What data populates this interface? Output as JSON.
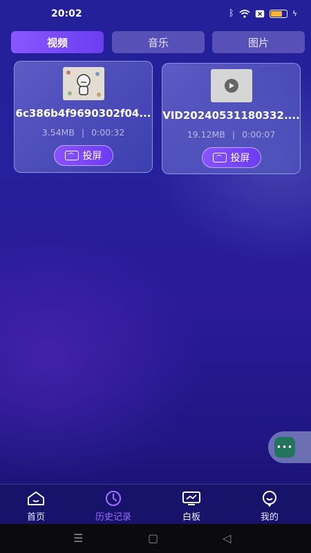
{
  "status_bar": {
    "time": "20:02"
  },
  "tabs": [
    {
      "label": "视频",
      "active": true
    },
    {
      "label": "音乐",
      "active": false
    },
    {
      "label": "图片",
      "active": false
    }
  ],
  "videos": [
    {
      "file_name": "6c386b4f9690302f04...",
      "size": "3.54MB",
      "duration": "0:00:32",
      "separator": "|",
      "cast_label": "投屏"
    },
    {
      "file_name": "VID20240531180332....",
      "size": "19.12MB",
      "duration": "0:00:07",
      "separator": "|",
      "cast_label": "投屏"
    }
  ],
  "floating_button": {
    "label": "•••"
  },
  "bottom_nav": [
    {
      "label": "首页",
      "icon": "home-icon",
      "active": false
    },
    {
      "label": "历史记录",
      "icon": "clock-icon",
      "active": true
    },
    {
      "label": "白板",
      "icon": "whiteboard-icon",
      "active": false
    },
    {
      "label": "我的",
      "icon": "profile-icon",
      "active": false
    }
  ],
  "system_nav": {
    "menu": "☰",
    "home": "▢",
    "back": "◁"
  },
  "colors": {
    "accent": "#8a52ff",
    "background": "#24209a",
    "nav_active": "#9b6bff"
  }
}
